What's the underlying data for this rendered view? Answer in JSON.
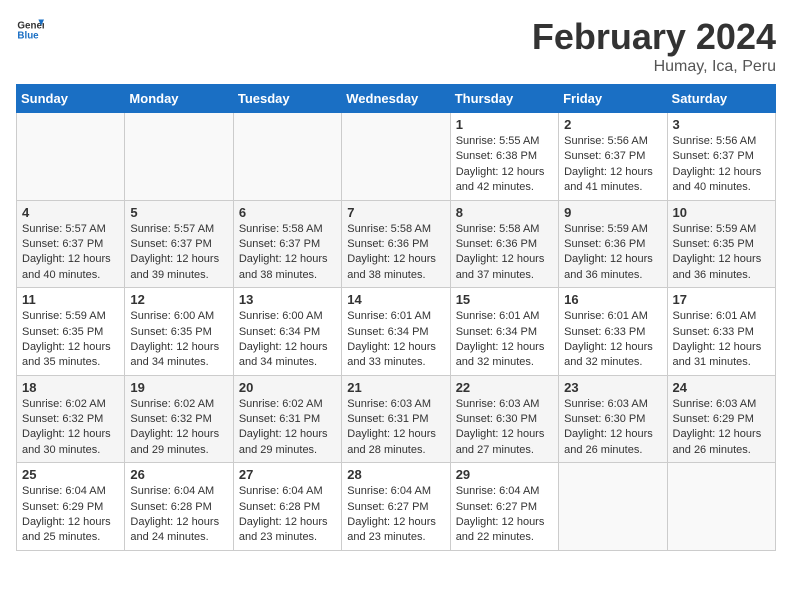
{
  "header": {
    "logo_general": "General",
    "logo_blue": "Blue",
    "title": "February 2024",
    "subtitle": "Humay, Ica, Peru"
  },
  "days_of_week": [
    "Sunday",
    "Monday",
    "Tuesday",
    "Wednesday",
    "Thursday",
    "Friday",
    "Saturday"
  ],
  "weeks": [
    [
      {
        "day": "",
        "info": ""
      },
      {
        "day": "",
        "info": ""
      },
      {
        "day": "",
        "info": ""
      },
      {
        "day": "",
        "info": ""
      },
      {
        "day": "1",
        "info": "Sunrise: 5:55 AM\nSunset: 6:38 PM\nDaylight: 12 hours and 42 minutes."
      },
      {
        "day": "2",
        "info": "Sunrise: 5:56 AM\nSunset: 6:37 PM\nDaylight: 12 hours and 41 minutes."
      },
      {
        "day": "3",
        "info": "Sunrise: 5:56 AM\nSunset: 6:37 PM\nDaylight: 12 hours and 40 minutes."
      }
    ],
    [
      {
        "day": "4",
        "info": "Sunrise: 5:57 AM\nSunset: 6:37 PM\nDaylight: 12 hours and 40 minutes."
      },
      {
        "day": "5",
        "info": "Sunrise: 5:57 AM\nSunset: 6:37 PM\nDaylight: 12 hours and 39 minutes."
      },
      {
        "day": "6",
        "info": "Sunrise: 5:58 AM\nSunset: 6:37 PM\nDaylight: 12 hours and 38 minutes."
      },
      {
        "day": "7",
        "info": "Sunrise: 5:58 AM\nSunset: 6:36 PM\nDaylight: 12 hours and 38 minutes."
      },
      {
        "day": "8",
        "info": "Sunrise: 5:58 AM\nSunset: 6:36 PM\nDaylight: 12 hours and 37 minutes."
      },
      {
        "day": "9",
        "info": "Sunrise: 5:59 AM\nSunset: 6:36 PM\nDaylight: 12 hours and 36 minutes."
      },
      {
        "day": "10",
        "info": "Sunrise: 5:59 AM\nSunset: 6:35 PM\nDaylight: 12 hours and 36 minutes."
      }
    ],
    [
      {
        "day": "11",
        "info": "Sunrise: 5:59 AM\nSunset: 6:35 PM\nDaylight: 12 hours and 35 minutes."
      },
      {
        "day": "12",
        "info": "Sunrise: 6:00 AM\nSunset: 6:35 PM\nDaylight: 12 hours and 34 minutes."
      },
      {
        "day": "13",
        "info": "Sunrise: 6:00 AM\nSunset: 6:34 PM\nDaylight: 12 hours and 34 minutes."
      },
      {
        "day": "14",
        "info": "Sunrise: 6:01 AM\nSunset: 6:34 PM\nDaylight: 12 hours and 33 minutes."
      },
      {
        "day": "15",
        "info": "Sunrise: 6:01 AM\nSunset: 6:34 PM\nDaylight: 12 hours and 32 minutes."
      },
      {
        "day": "16",
        "info": "Sunrise: 6:01 AM\nSunset: 6:33 PM\nDaylight: 12 hours and 32 minutes."
      },
      {
        "day": "17",
        "info": "Sunrise: 6:01 AM\nSunset: 6:33 PM\nDaylight: 12 hours and 31 minutes."
      }
    ],
    [
      {
        "day": "18",
        "info": "Sunrise: 6:02 AM\nSunset: 6:32 PM\nDaylight: 12 hours and 30 minutes."
      },
      {
        "day": "19",
        "info": "Sunrise: 6:02 AM\nSunset: 6:32 PM\nDaylight: 12 hours and 29 minutes."
      },
      {
        "day": "20",
        "info": "Sunrise: 6:02 AM\nSunset: 6:31 PM\nDaylight: 12 hours and 29 minutes."
      },
      {
        "day": "21",
        "info": "Sunrise: 6:03 AM\nSunset: 6:31 PM\nDaylight: 12 hours and 28 minutes."
      },
      {
        "day": "22",
        "info": "Sunrise: 6:03 AM\nSunset: 6:30 PM\nDaylight: 12 hours and 27 minutes."
      },
      {
        "day": "23",
        "info": "Sunrise: 6:03 AM\nSunset: 6:30 PM\nDaylight: 12 hours and 26 minutes."
      },
      {
        "day": "24",
        "info": "Sunrise: 6:03 AM\nSunset: 6:29 PM\nDaylight: 12 hours and 26 minutes."
      }
    ],
    [
      {
        "day": "25",
        "info": "Sunrise: 6:04 AM\nSunset: 6:29 PM\nDaylight: 12 hours and 25 minutes."
      },
      {
        "day": "26",
        "info": "Sunrise: 6:04 AM\nSunset: 6:28 PM\nDaylight: 12 hours and 24 minutes."
      },
      {
        "day": "27",
        "info": "Sunrise: 6:04 AM\nSunset: 6:28 PM\nDaylight: 12 hours and 23 minutes."
      },
      {
        "day": "28",
        "info": "Sunrise: 6:04 AM\nSunset: 6:27 PM\nDaylight: 12 hours and 23 minutes."
      },
      {
        "day": "29",
        "info": "Sunrise: 6:04 AM\nSunset: 6:27 PM\nDaylight: 12 hours and 22 minutes."
      },
      {
        "day": "",
        "info": ""
      },
      {
        "day": "",
        "info": ""
      }
    ]
  ]
}
